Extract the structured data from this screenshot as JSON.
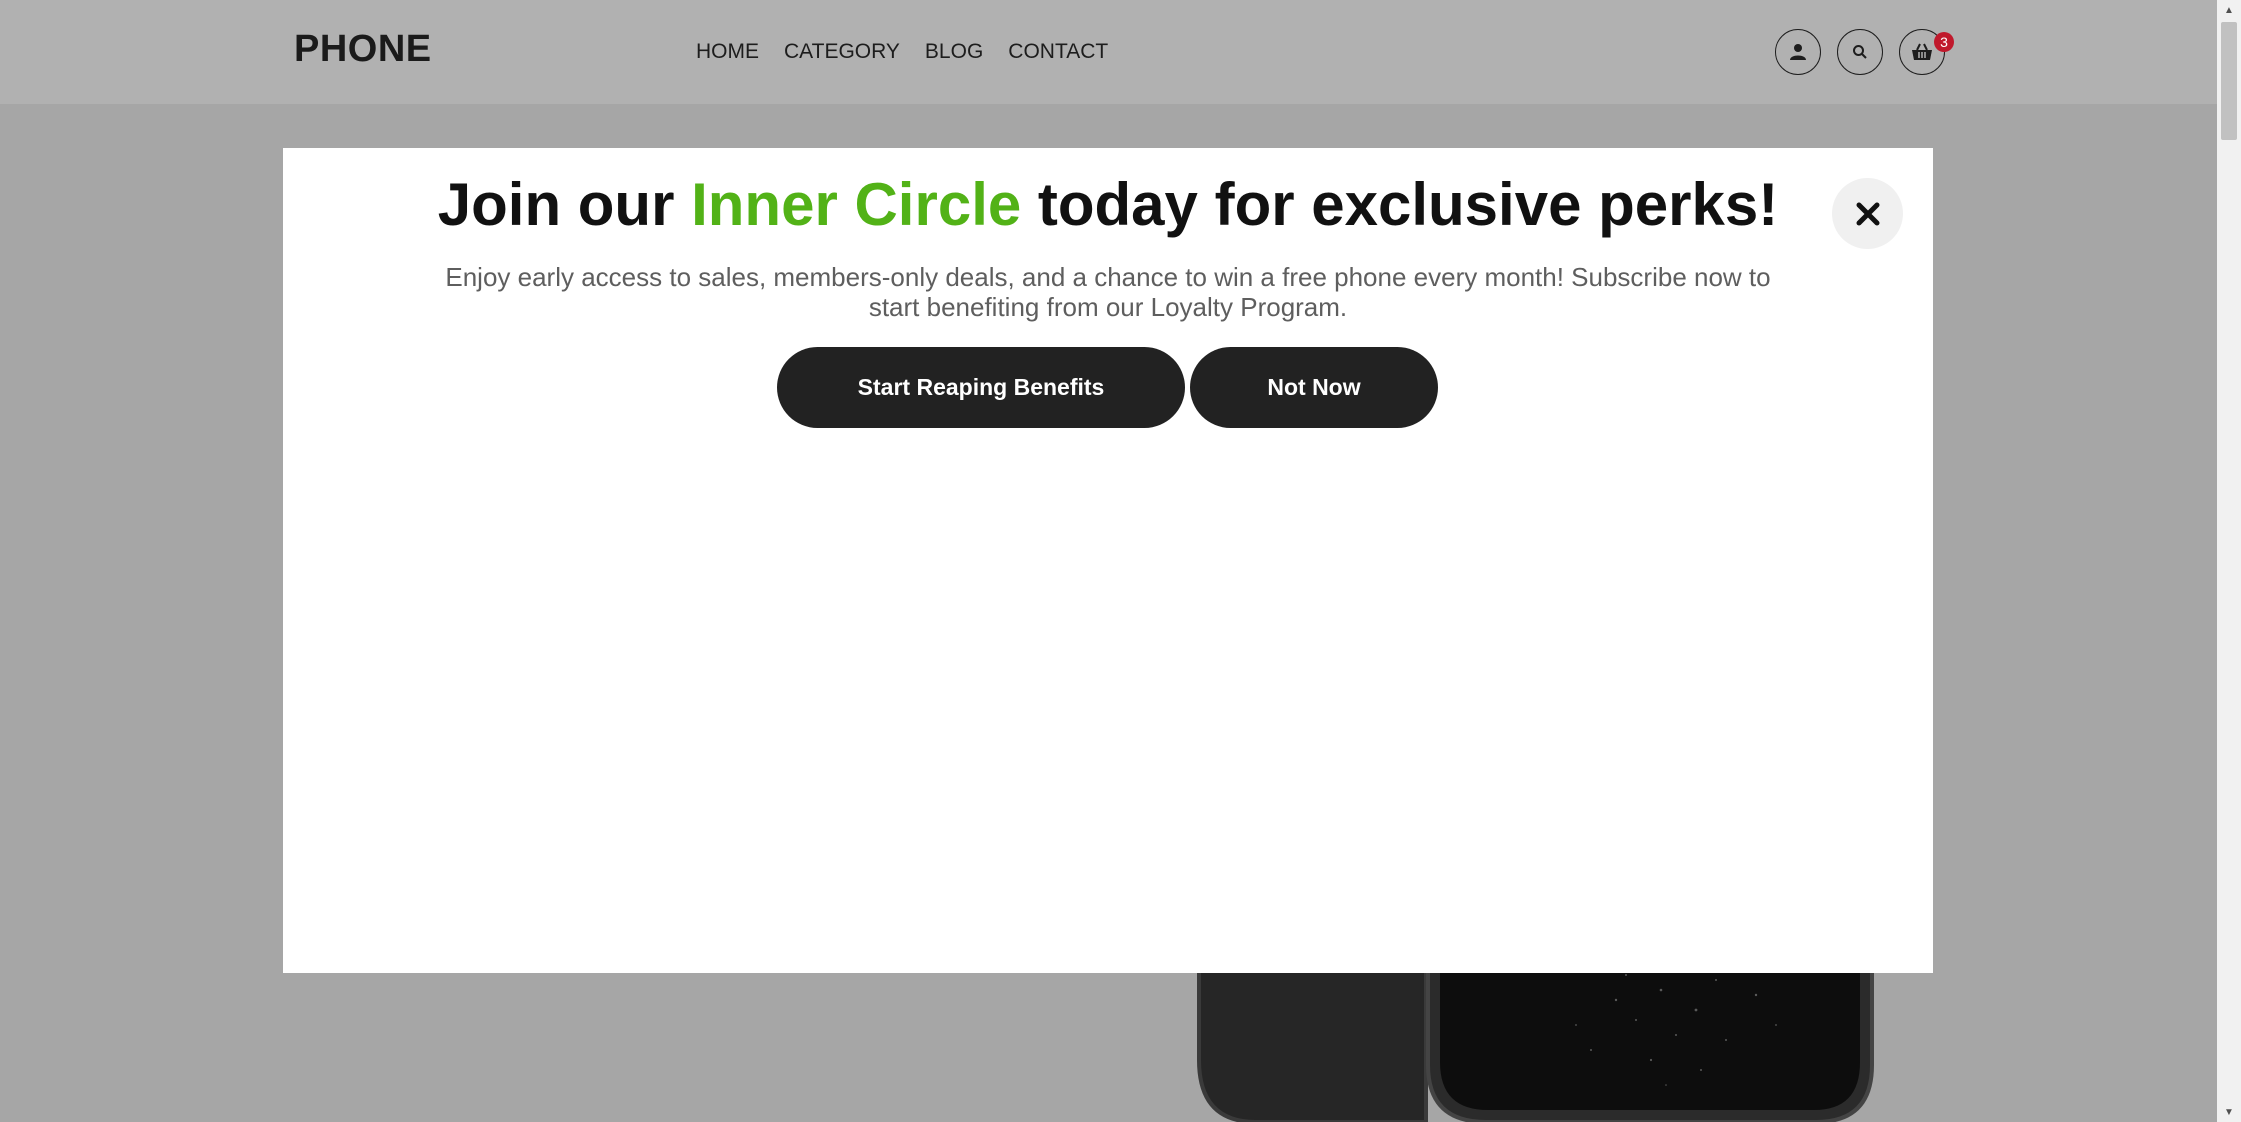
{
  "header": {
    "logo": "PHONE",
    "nav": [
      "HOME",
      "CATEGORY",
      "BLOG",
      "CONTACT"
    ],
    "cart_count": "3",
    "icons": [
      "user-icon",
      "search-icon",
      "cart-icon"
    ]
  },
  "modal": {
    "title_before": "Join our ",
    "title_accent": "Inner Circle",
    "title_after": " today for exclusive perks!",
    "description": "Enjoy early access to sales, members-only deals, and a chance to win a free phone every month! Subscribe now to start benefiting from our Loyalty Program.",
    "primary_button": "Start Reaping Benefits",
    "secondary_button": "Not Now",
    "close_icon": "close-icon"
  },
  "colors": {
    "accent": "#52b217",
    "button_bg": "#222222",
    "badge": "#c0192c",
    "overlay": "#a6a6a6"
  }
}
